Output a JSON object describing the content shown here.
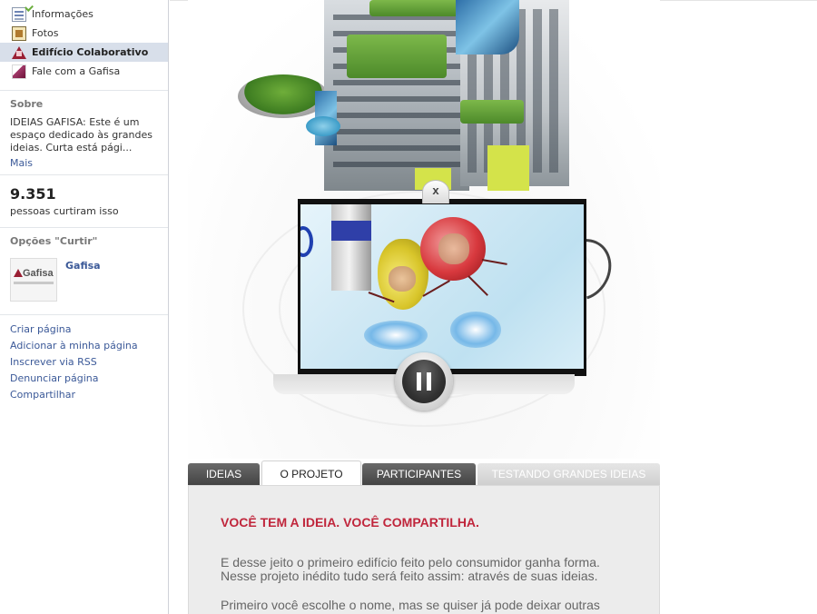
{
  "sidebar": {
    "nav": [
      {
        "label": "Informações",
        "icon": "info-page-icon"
      },
      {
        "label": "Fotos",
        "icon": "photos-icon"
      },
      {
        "label": "Edifício Colaborativo",
        "icon": "gafisa-triangle-icon",
        "active": true
      },
      {
        "label": "Fale com a Gafisa",
        "icon": "gafisa-quill-icon"
      }
    ],
    "about_heading": "Sobre",
    "about_text": "IDEIAS GAFISA: Este é um espaço dedicado às grandes ideias. Curta está pági...",
    "about_more": "Mais",
    "likes_count": "9.351",
    "likes_label": "pessoas curtiram isso",
    "likes_heading": "Opções \"Curtir\"",
    "fan_page": {
      "name": "Gafisa",
      "logo_text": "Gafisa"
    },
    "links": [
      "Criar página",
      "Adicionar à minha página",
      "Inscrever via RSS",
      "Denunciar página",
      "Compartilhar"
    ]
  },
  "player": {
    "close_label": "x",
    "state": "playing"
  },
  "tabs": [
    {
      "label": "IDEIAS",
      "active": false
    },
    {
      "label": "O PROJETO",
      "active": true
    },
    {
      "label": "PARTICIPANTES",
      "active": false
    },
    {
      "label": "TESTANDO GRANDES IDEIAS",
      "active": false
    }
  ],
  "content": {
    "title": "VOCÊ TEM A IDEIA. VOCÊ COMPARTILHA.",
    "paragraph1": "E desse jeito o primeiro edifício feito pelo consumidor ganha forma. Nesse projeto inédito tudo será feito assim: através de suas ideias.",
    "paragraph2": "Primeiro você escolhe o nome, mas se quiser já pode deixar outras"
  },
  "colors": {
    "fb_link": "#3b5998",
    "active_nav_bg": "#d8dfea",
    "accent_red": "#c0263c",
    "tab_dark": "#4f4f4f",
    "content_bg": "#ececec"
  }
}
